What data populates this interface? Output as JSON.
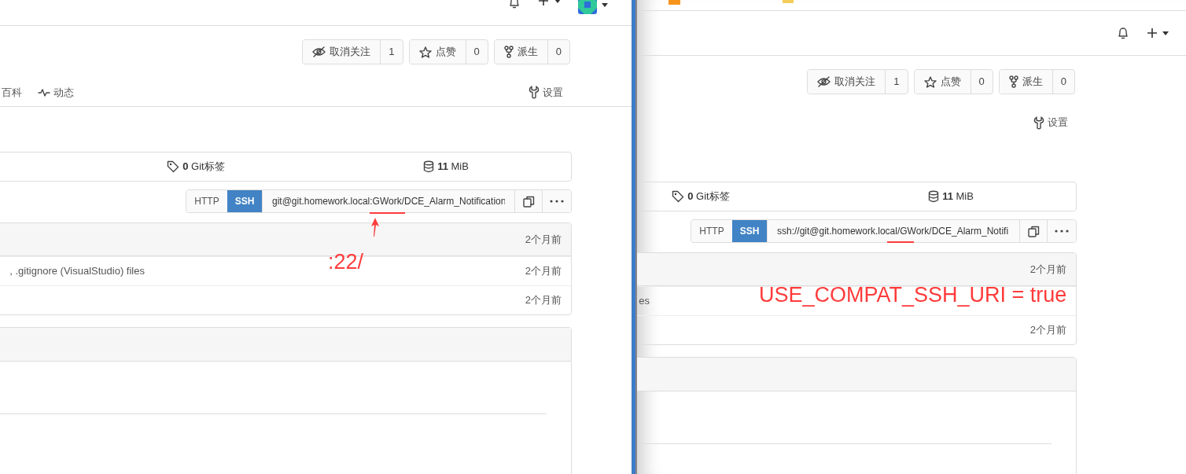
{
  "panes": [
    {
      "topbar": {
        "items": [
          {
            "kind": "bell"
          },
          {
            "kind": "plus"
          },
          {
            "kind": "avatar"
          }
        ]
      },
      "repo_buttons": [
        {
          "kind": "watch",
          "label": "取消关注",
          "count": "1"
        },
        {
          "kind": "star",
          "label": "点赞",
          "count": "0"
        },
        {
          "kind": "fork",
          "label": "派生",
          "count": "0"
        }
      ],
      "tabs": [
        {
          "kind": "wiki",
          "label": "百科"
        },
        {
          "kind": "activity",
          "label": "动态"
        },
        {
          "kind": "settings",
          "label": "设置"
        }
      ],
      "stats": [
        {
          "kind": "tags",
          "text": "**0** Git标签"
        },
        {
          "kind": "size",
          "text": "**11** MiB"
        }
      ],
      "clone": {
        "protocols": [
          {
            "label": "HTTP",
            "selected": false
          },
          {
            "label": "SSH",
            "selected": true
          }
        ],
        "url": "git@git.homework.local:GWork/DCE_Alarm_Notification"
      },
      "commits": [
        {
          "time": "2个月前"
        },
        {
          "message": ", .gitignore (VisualStudio) files",
          "time": "2个月前"
        },
        {
          "time": "2个月前"
        }
      ],
      "annotations": [
        {
          "kind": "underline"
        },
        {
          "kind": "arrow"
        },
        {
          "kind": "note",
          "text": ":22/"
        }
      ]
    },
    {
      "bookmarks_bar": {
        "icons": [
          {
            "kind": "site"
          },
          {
            "kind": "folder"
          }
        ]
      },
      "topbar": {
        "items": [
          {
            "kind": "bell"
          },
          {
            "kind": "plus"
          }
        ]
      },
      "repo_buttons": [
        {
          "kind": "watch",
          "label": "取消关注",
          "count": "1"
        },
        {
          "kind": "star",
          "label": "点赞",
          "count": "0"
        },
        {
          "kind": "fork",
          "label": "派生",
          "count": "0"
        }
      ],
      "tabs": [
        {
          "kind": "settings",
          "label": "设置"
        }
      ],
      "stats": [
        {
          "kind": "tags",
          "text": "**0** Git标签"
        },
        {
          "kind": "size",
          "text": "**11** MiB"
        }
      ],
      "clone": {
        "protocols": [
          {
            "label": "HTTP",
            "selected": false
          },
          {
            "label": "SSH",
            "selected": true
          }
        ],
        "url": "ssh://git@git.homework.local/GWork/DCE_Alarm_Notifi"
      },
      "commits": [
        {
          "time": "2个月前"
        },
        {
          "message": "es"
        },
        {
          "time": "2个月前"
        }
      ],
      "annotations": [
        {
          "kind": "underline"
        },
        {
          "kind": "note",
          "text": "USE_COMPAT_SSH_URI = true"
        }
      ]
    }
  ]
}
